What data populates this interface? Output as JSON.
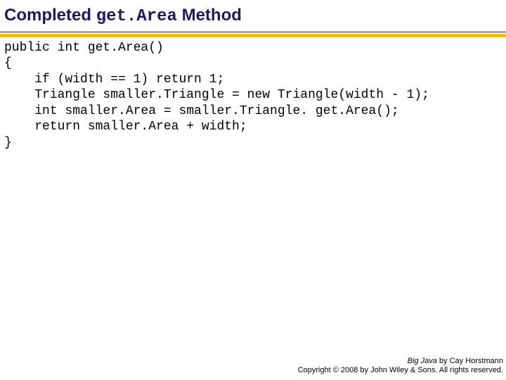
{
  "title": {
    "prefix": "Completed ",
    "code": "get.Area",
    "suffix": " Method"
  },
  "code": {
    "l1": "public int get.Area()",
    "l2": "{",
    "l3": "    if (width == 1) return 1;",
    "l4": "    Triangle smaller.Triangle = new Triangle(width - 1);",
    "l5": "    int smaller.Area = smaller.Triangle. get.Area();",
    "l6": "    return smaller.Area + width;",
    "l7": "}"
  },
  "footer": {
    "book_title": "Big Java",
    "byline": " by Cay Horstmann",
    "copyright": "Copyright © 2008 by John Wiley & Sons.  All rights reserved."
  }
}
